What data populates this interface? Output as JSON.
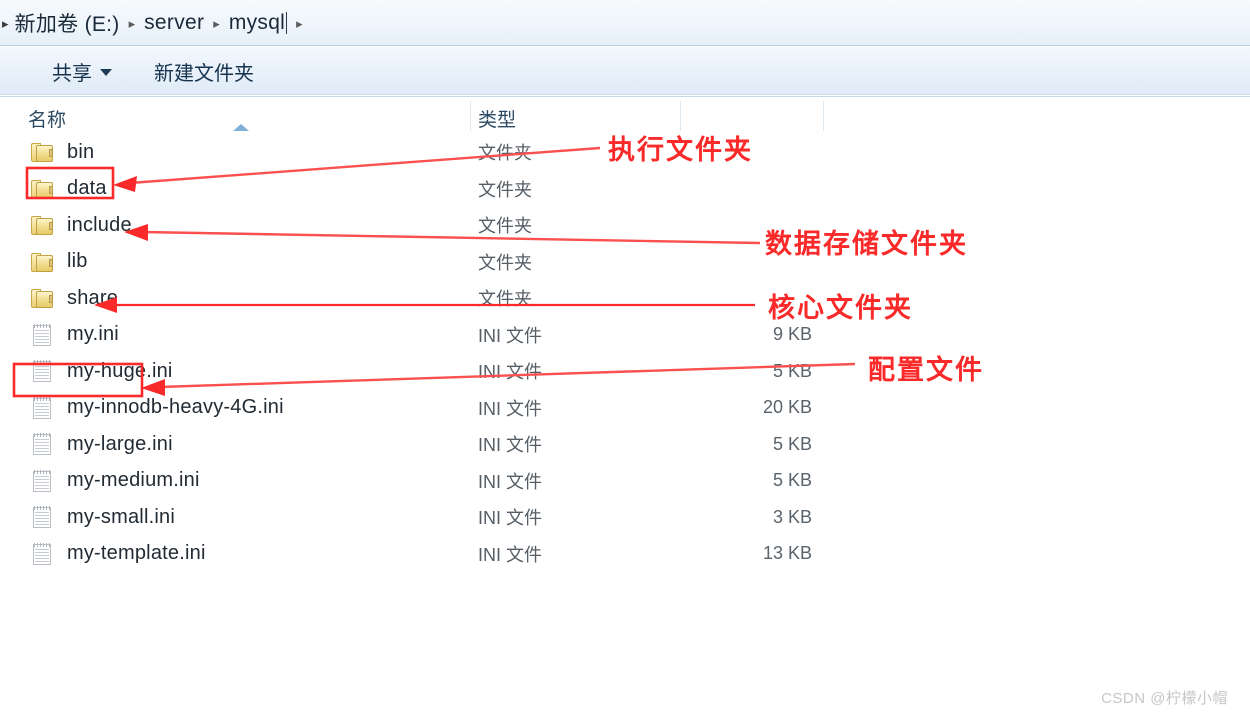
{
  "window": {
    "title": "mysql"
  },
  "breadcrumb": {
    "lead_chevron": "▸",
    "separator": "▸",
    "items": [
      {
        "label": "新加卷 (E:)"
      },
      {
        "label": "server"
      },
      {
        "label": "mysql"
      }
    ]
  },
  "toolbar": {
    "share_label": "共享",
    "new_folder_label": "新建文件夹"
  },
  "columns": {
    "name": "名称",
    "type": "类型",
    "size": ""
  },
  "files": [
    {
      "name": "bin",
      "type": "文件夹",
      "size": "",
      "icon": "folder-icon",
      "highlighted": true
    },
    {
      "name": "data",
      "type": "文件夹",
      "size": "",
      "icon": "folder-icon",
      "highlighted": false
    },
    {
      "name": "include",
      "type": "文件夹",
      "size": "",
      "icon": "folder-icon",
      "highlighted": false
    },
    {
      "name": "lib",
      "type": "文件夹",
      "size": "",
      "icon": "folder-icon",
      "highlighted": false
    },
    {
      "name": "share",
      "type": "文件夹",
      "size": "",
      "icon": "folder-icon",
      "highlighted": false
    },
    {
      "name": "my.ini",
      "type": "INI 文件",
      "size": "9 KB",
      "icon": "ini-file-icon",
      "highlighted": true
    },
    {
      "name": "my-huge.ini",
      "type": "INI 文件",
      "size": "5 KB",
      "icon": "ini-file-icon",
      "highlighted": false
    },
    {
      "name": "my-innodb-heavy-4G.ini",
      "type": "INI 文件",
      "size": "20 KB",
      "icon": "ini-file-icon",
      "highlighted": false
    },
    {
      "name": "my-large.ini",
      "type": "INI 文件",
      "size": "5 KB",
      "icon": "ini-file-icon",
      "highlighted": false
    },
    {
      "name": "my-medium.ini",
      "type": "INI 文件",
      "size": "5 KB",
      "icon": "ini-file-icon",
      "highlighted": false
    },
    {
      "name": "my-small.ini",
      "type": "INI 文件",
      "size": "3 KB",
      "icon": "ini-file-icon",
      "highlighted": false
    },
    {
      "name": "my-template.ini",
      "type": "INI 文件",
      "size": "13 KB",
      "icon": "ini-file-icon",
      "highlighted": false
    }
  ],
  "annotations": {
    "color": "#fb2a2a",
    "items": [
      {
        "text": "执行文件夹",
        "target": "bin"
      },
      {
        "text": "数据存储文件夹",
        "target": "data"
      },
      {
        "text": "核心文件夹",
        "target": "lib"
      },
      {
        "text": "配置文件",
        "target": "my.ini"
      }
    ]
  },
  "watermark": {
    "text": "CSDN @柠檬小帽"
  }
}
